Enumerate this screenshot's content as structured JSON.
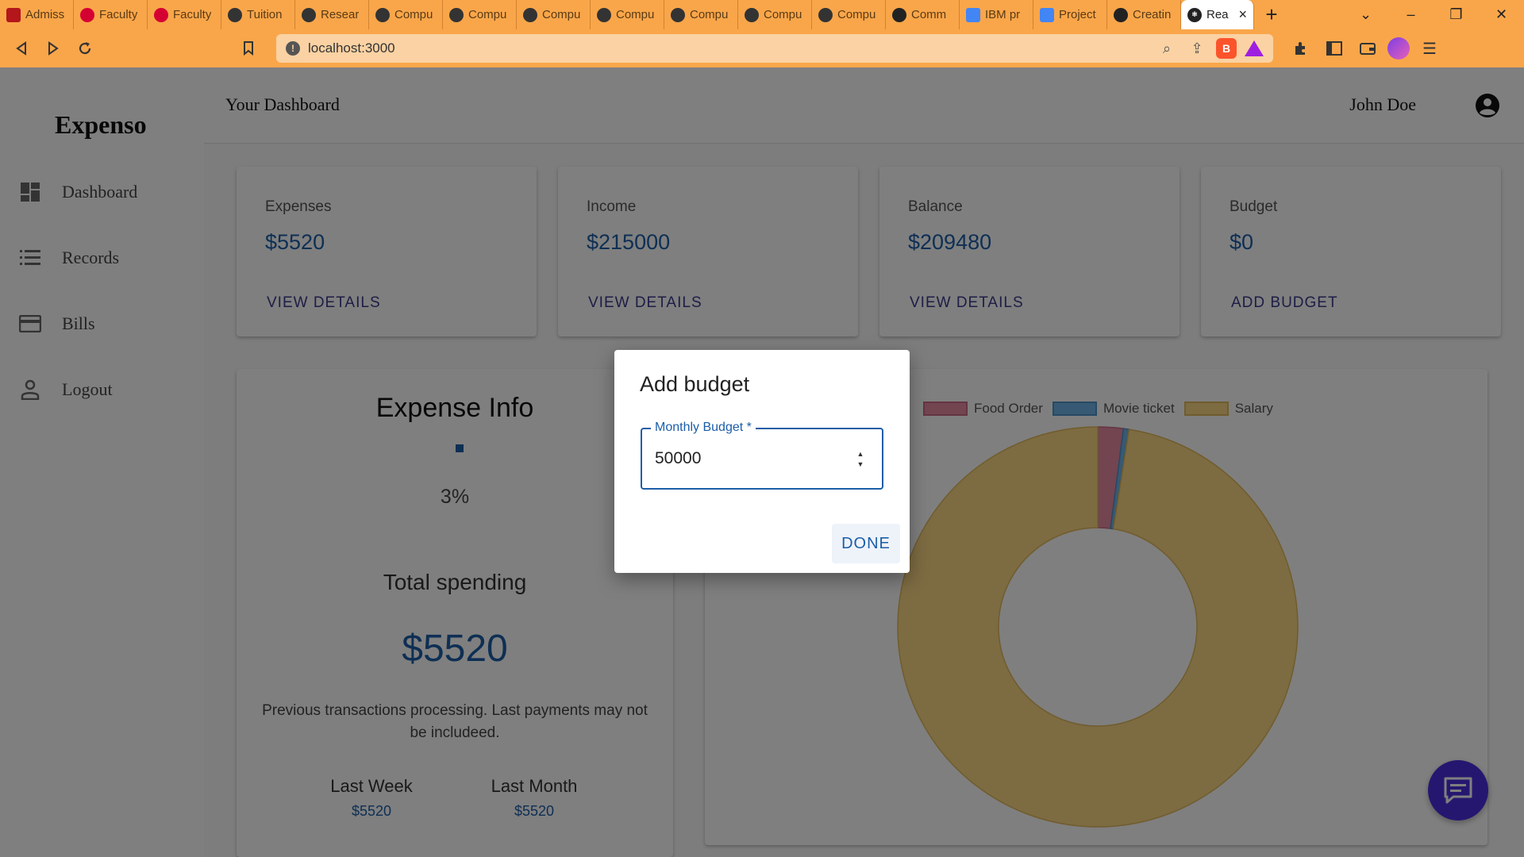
{
  "browser": {
    "tabs": [
      {
        "label": "Admiss",
        "icon": "red-square-icon",
        "color": "#b3161b"
      },
      {
        "label": "Faculty",
        "icon": "uic-logo-icon",
        "color": "#d50032"
      },
      {
        "label": "Faculty",
        "icon": "uic-logo-icon",
        "color": "#d50032"
      },
      {
        "label": "Tuition",
        "icon": "site-icon",
        "color": "#333333"
      },
      {
        "label": "Resear",
        "icon": "site-icon",
        "color": "#333333"
      },
      {
        "label": "Compu",
        "icon": "site-icon",
        "color": "#333333"
      },
      {
        "label": "Compu",
        "icon": "site-icon",
        "color": "#333333"
      },
      {
        "label": "Compu",
        "icon": "site-icon",
        "color": "#333333"
      },
      {
        "label": "Compu",
        "icon": "site-icon",
        "color": "#333333"
      },
      {
        "label": "Compu",
        "icon": "site-icon",
        "color": "#333333"
      },
      {
        "label": "Compu",
        "icon": "site-icon",
        "color": "#333333"
      },
      {
        "label": "Compu",
        "icon": "site-icon",
        "color": "#333333"
      },
      {
        "label": "Comm",
        "icon": "github-icon",
        "color": "#222222"
      },
      {
        "label": "IBM pr",
        "icon": "docs-icon",
        "color": "#4285f4"
      },
      {
        "label": "Project",
        "icon": "docs-icon",
        "color": "#4285f4"
      },
      {
        "label": "Creatin",
        "icon": "globe-icon",
        "color": "#222222"
      }
    ],
    "active_tab": {
      "label": "Rea",
      "icon": "react-icon",
      "color": "#222222"
    },
    "url": "localhost:3000"
  },
  "sidebar": {
    "brand": "Expenso",
    "items": [
      {
        "label": "Dashboard",
        "icon": "dashboard-icon"
      },
      {
        "label": "Records",
        "icon": "list-icon"
      },
      {
        "label": "Bills",
        "icon": "credit-card-icon"
      },
      {
        "label": "Logout",
        "icon": "person-icon"
      }
    ]
  },
  "header": {
    "title": "Your Dashboard",
    "user": "John Doe"
  },
  "cards": [
    {
      "label": "Expenses",
      "value": "$5520",
      "action": "VIEW DETAILS"
    },
    {
      "label": "Income",
      "value": "$215000",
      "action": "VIEW DETAILS"
    },
    {
      "label": "Balance",
      "value": "$209480",
      "action": "VIEW DETAILS"
    },
    {
      "label": "Budget",
      "value": "$0",
      "action": "ADD BUDGET"
    }
  ],
  "expense_info": {
    "title": "Expense Info",
    "percent": "3%",
    "subtitle": "Total spending",
    "total": "$5520",
    "note": "Previous transactions processing. Last payments may not be includeed.",
    "last_week_label": "Last Week",
    "last_week_value": "$5520",
    "last_month_label": "Last Month",
    "last_month_value": "$5520"
  },
  "chart_data": {
    "type": "pie",
    "variant": "doughnut",
    "categories": [
      "Food Order",
      "Movie ticket",
      "Salary"
    ],
    "values": [
      4520,
      1000,
      215000
    ],
    "colors": [
      "#e58aa3",
      "#6fb2e6",
      "#fbd784"
    ],
    "legend": "top"
  },
  "dialog": {
    "title": "Add budget",
    "field_label": "Monthly Budget *",
    "field_value": "50000",
    "done_label": "DONE"
  },
  "colors": {
    "accent": "#1c5ea8",
    "fab": "#4a2fe0",
    "browser_chrome": "#f9a64a"
  }
}
